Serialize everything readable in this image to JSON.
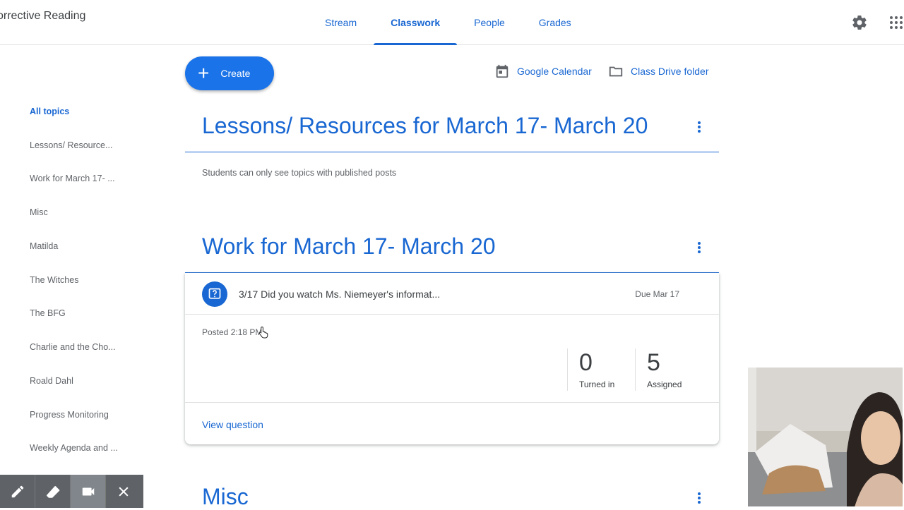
{
  "header": {
    "class_title": "orrective Reading",
    "tabs": [
      {
        "label": "Stream",
        "active": false
      },
      {
        "label": "Classwork",
        "active": true
      },
      {
        "label": "People",
        "active": false
      },
      {
        "label": "Grades",
        "active": false
      }
    ],
    "icons": [
      "gear-icon",
      "apps-grid-icon"
    ]
  },
  "sidebar": {
    "items": [
      {
        "label": "All topics",
        "active": true
      },
      {
        "label": "Lessons/ Resource..."
      },
      {
        "label": "Work for March 17- ..."
      },
      {
        "label": "Misc"
      },
      {
        "label": "Matilda"
      },
      {
        "label": "The Witches"
      },
      {
        "label": "The BFG"
      },
      {
        "label": "Charlie and the Cho..."
      },
      {
        "label": "Roald Dahl"
      },
      {
        "label": "Progress Monitoring"
      },
      {
        "label": "Weekly Agenda and ..."
      }
    ]
  },
  "toolbar": {
    "create_label": "Create",
    "calendar_label": "Google Calendar",
    "drive_label": "Class Drive folder"
  },
  "topics": [
    {
      "title": "Lessons/ Resources for March 17- March 20",
      "note": "Students can only see topics with published posts"
    },
    {
      "title": "Work for March 17- March 20"
    },
    {
      "title": "Misc"
    }
  ],
  "assignment": {
    "title": "3/17 Did you watch Ms. Niemeyer's informat...",
    "due": "Due Mar 17",
    "posted": "Posted 2:18 PM",
    "turned_in_count": "0",
    "turned_in_label": "Turned in",
    "assigned_count": "5",
    "assigned_label": "Assigned",
    "view_label": "View question"
  },
  "recorder": {
    "tools": [
      "pencil-icon",
      "eraser-icon",
      "camera-icon",
      "close-icon"
    ],
    "selected": "camera-icon"
  },
  "colors": {
    "accent": "#1967d2",
    "create_button": "#1a73e8",
    "text": "#3c4043",
    "muted": "#5f6368"
  }
}
